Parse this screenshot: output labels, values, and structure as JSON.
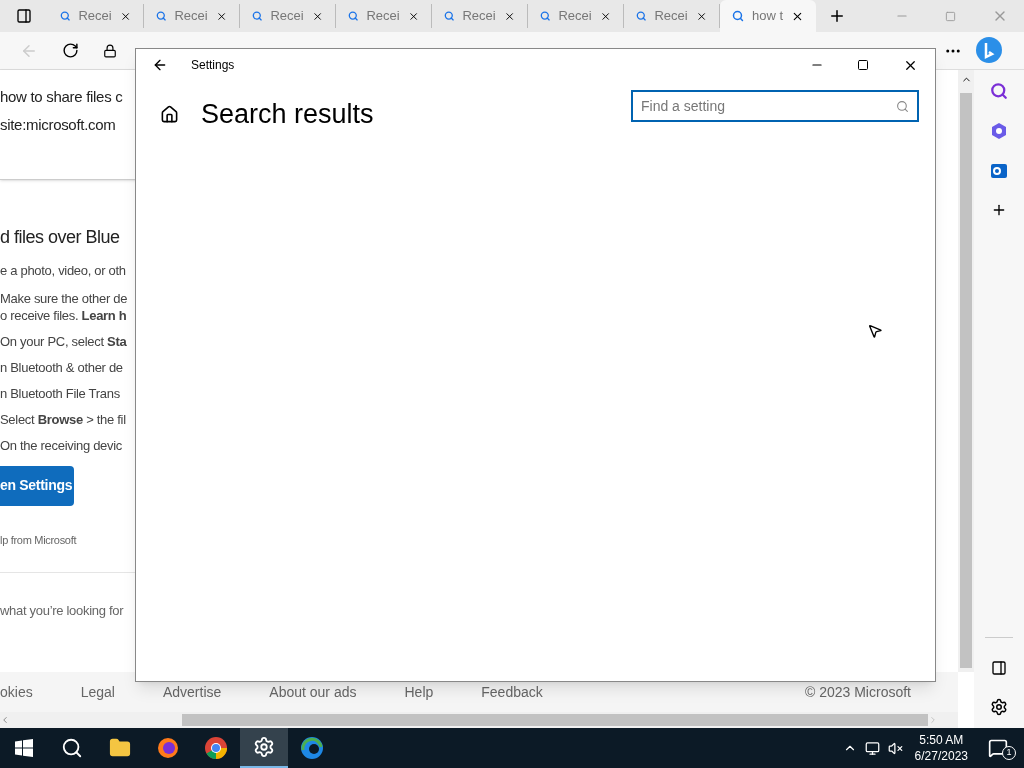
{
  "browser": {
    "tabs": [
      {
        "label": "Recei",
        "selected": false
      },
      {
        "label": "Recei",
        "selected": false
      },
      {
        "label": "Recei",
        "selected": false
      },
      {
        "label": "Recei",
        "selected": false
      },
      {
        "label": "Recei",
        "selected": false
      },
      {
        "label": "Recei",
        "selected": false
      },
      {
        "label": "Recei",
        "selected": false
      },
      {
        "label": "how t",
        "selected": true
      }
    ]
  },
  "page": {
    "search_query": [
      "how to share files c",
      "site:microsoft.com"
    ],
    "heading": "d files over Blue",
    "intro": "e a photo, video, or oth",
    "steps": [
      [
        "Make sure the other de",
        "o receive files. **Learn h**"
      ],
      [
        "On your PC, select **Sta**"
      ],
      [
        "n Bluetooth & other de"
      ],
      [
        "n Bluetooth File Trans"
      ],
      [
        "Select **Browse** > the fil"
      ],
      [
        "On the receiving devic"
      ]
    ],
    "button": "en Settings",
    "source": "lp from Microsoft",
    "feedback": "what you’re looking for",
    "footer": [
      "okies",
      "Legal",
      "Advertise",
      "About our ads",
      "Help",
      "Feedback",
      "© 2023 Microsoft"
    ]
  },
  "settings": {
    "title": "Settings",
    "heading": "Search results",
    "search": {
      "placeholder": "Find a setting",
      "focused": true
    }
  },
  "taskbar": {
    "apps": [
      {
        "kind": "start",
        "selected": false
      },
      {
        "kind": "search",
        "selected": false
      },
      {
        "kind": "files",
        "selected": false
      },
      {
        "kind": "firefox",
        "selected": false
      },
      {
        "kind": "chrome",
        "selected": false
      },
      {
        "kind": "settings",
        "selected": true
      },
      {
        "kind": "edge",
        "selected": false
      }
    ],
    "time": "5:50 AM",
    "date": "6/27/2023",
    "notifications": "1"
  }
}
